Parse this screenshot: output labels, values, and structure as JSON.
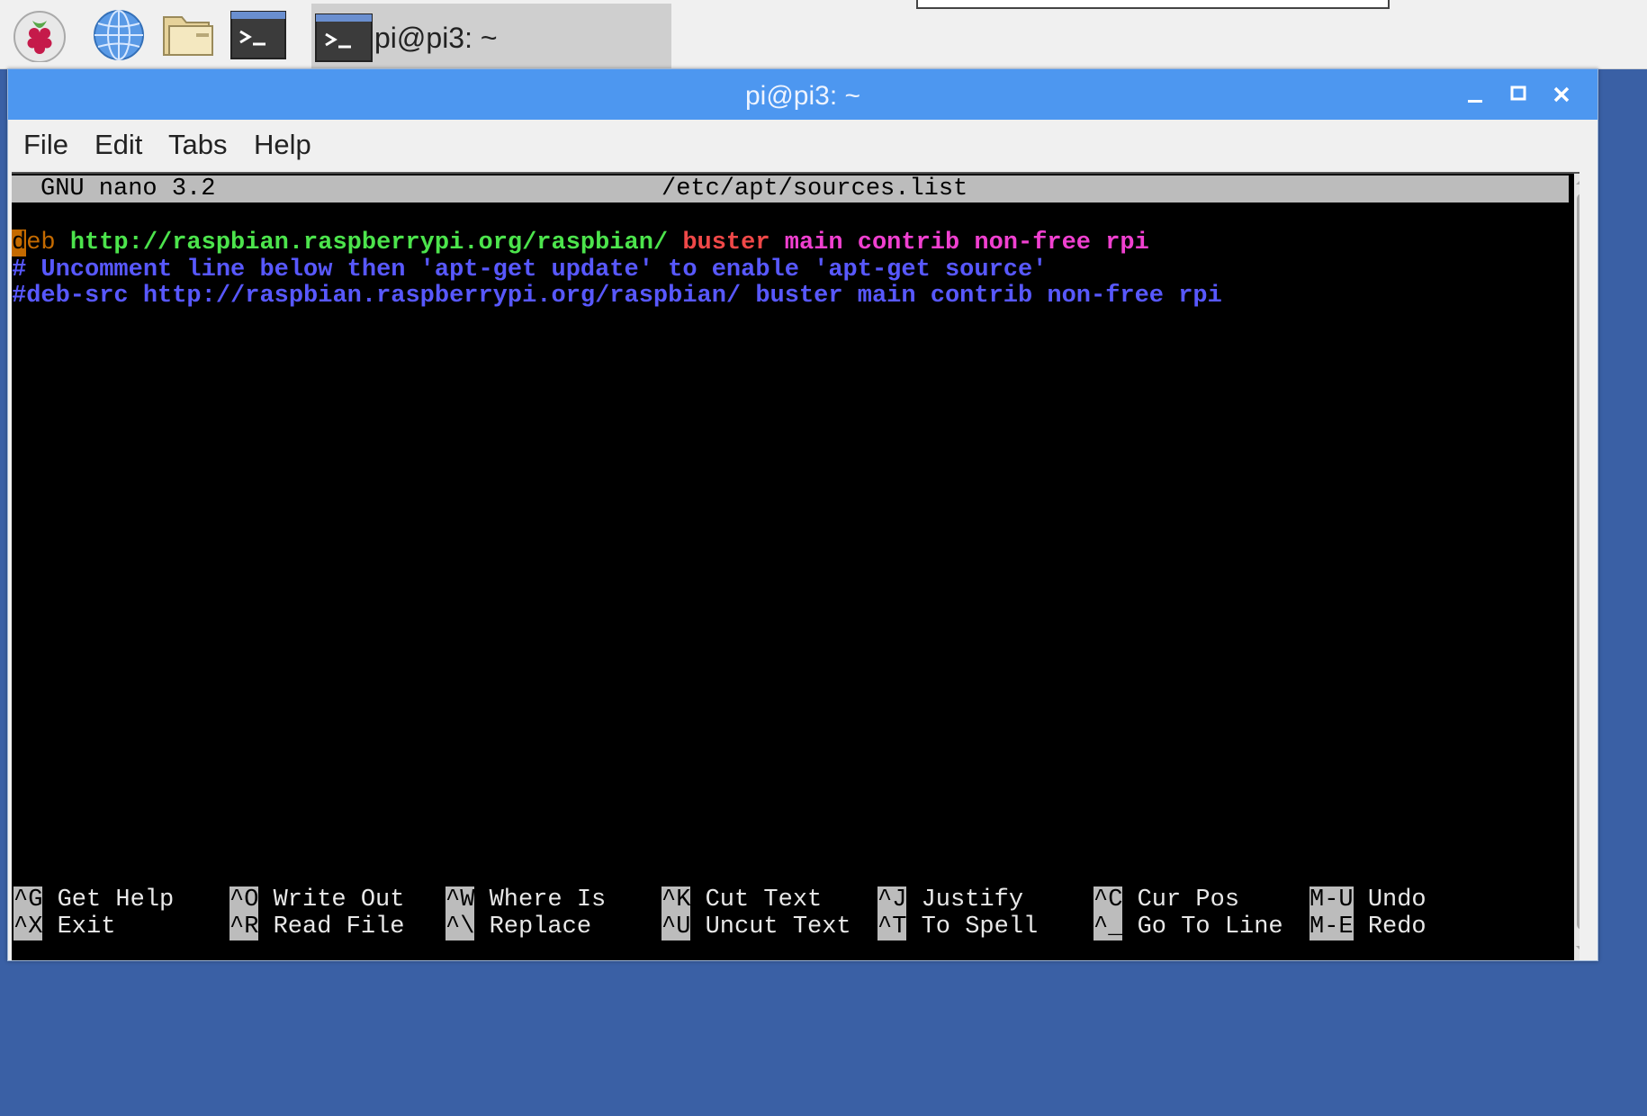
{
  "taskbar": {
    "icons": [
      "raspberry-menu-icon",
      "web-browser-icon",
      "file-manager-icon",
      "terminal-icon"
    ],
    "task_label": "pi@pi3: ~"
  },
  "window": {
    "title": "pi@pi3: ~",
    "controls": [
      "minimize-icon",
      "maximize-icon",
      "close-icon"
    ]
  },
  "menubar": {
    "file": "File",
    "edit": "Edit",
    "tabs": "Tabs",
    "help": "Help"
  },
  "nano": {
    "version": "GNU nano 3.2",
    "filename": "/etc/apt/sources.list",
    "lines": {
      "l1_cursor": "d",
      "l1_keyword": "eb",
      "l1_url": "http://raspbian.raspberrypi.org/raspbian/",
      "l1_dist": "buster",
      "l1_components": "main contrib non-free rpi",
      "l2": "# Uncomment line below then 'apt-get update' to enable 'apt-get source'",
      "l3": "#deb-src http://raspbian.raspberrypi.org/raspbian/ buster main contrib non-free rpi"
    },
    "shortcuts": [
      {
        "key": "^G",
        "label": "Get Help"
      },
      {
        "key": "^O",
        "label": "Write Out"
      },
      {
        "key": "^W",
        "label": "Where Is"
      },
      {
        "key": "^K",
        "label": "Cut Text"
      },
      {
        "key": "^J",
        "label": "Justify"
      },
      {
        "key": "^C",
        "label": "Cur Pos"
      },
      {
        "key": "M-U",
        "label": "Undo"
      },
      {
        "key": "^X",
        "label": "Exit"
      },
      {
        "key": "^R",
        "label": "Read File"
      },
      {
        "key": "^\\",
        "label": "Replace"
      },
      {
        "key": "^U",
        "label": "Uncut Text"
      },
      {
        "key": "^T",
        "label": "To Spell"
      },
      {
        "key": "^_",
        "label": "Go To Line"
      },
      {
        "key": "M-E",
        "label": "Redo"
      }
    ]
  },
  "colors": {
    "desktop": "#3a60a5",
    "titlebar": "#4d97f0",
    "url_green": "#4ce44c",
    "dist_red": "#f04848",
    "components_magenta": "#f040d0",
    "comment_blue": "#5858ff",
    "cursor_orange": "#c46a00"
  }
}
